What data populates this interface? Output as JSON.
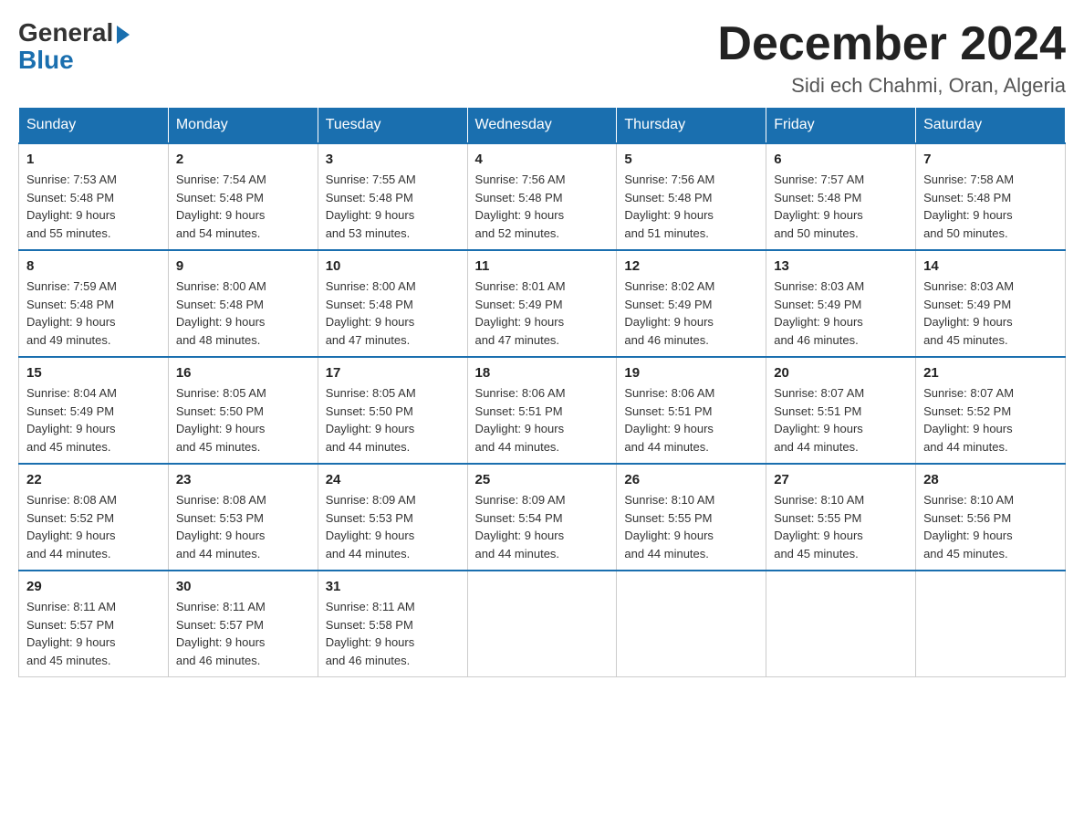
{
  "logo": {
    "general": "General",
    "blue": "Blue"
  },
  "header": {
    "title": "December 2024",
    "subtitle": "Sidi ech Chahmi, Oran, Algeria"
  },
  "days_of_week": [
    "Sunday",
    "Monday",
    "Tuesday",
    "Wednesday",
    "Thursday",
    "Friday",
    "Saturday"
  ],
  "weeks": [
    [
      {
        "day": "1",
        "sunrise": "7:53 AM",
        "sunset": "5:48 PM",
        "daylight": "9 hours and 55 minutes."
      },
      {
        "day": "2",
        "sunrise": "7:54 AM",
        "sunset": "5:48 PM",
        "daylight": "9 hours and 54 minutes."
      },
      {
        "day": "3",
        "sunrise": "7:55 AM",
        "sunset": "5:48 PM",
        "daylight": "9 hours and 53 minutes."
      },
      {
        "day": "4",
        "sunrise": "7:56 AM",
        "sunset": "5:48 PM",
        "daylight": "9 hours and 52 minutes."
      },
      {
        "day": "5",
        "sunrise": "7:56 AM",
        "sunset": "5:48 PM",
        "daylight": "9 hours and 51 minutes."
      },
      {
        "day": "6",
        "sunrise": "7:57 AM",
        "sunset": "5:48 PM",
        "daylight": "9 hours and 50 minutes."
      },
      {
        "day": "7",
        "sunrise": "7:58 AM",
        "sunset": "5:48 PM",
        "daylight": "9 hours and 50 minutes."
      }
    ],
    [
      {
        "day": "8",
        "sunrise": "7:59 AM",
        "sunset": "5:48 PM",
        "daylight": "9 hours and 49 minutes."
      },
      {
        "day": "9",
        "sunrise": "8:00 AM",
        "sunset": "5:48 PM",
        "daylight": "9 hours and 48 minutes."
      },
      {
        "day": "10",
        "sunrise": "8:00 AM",
        "sunset": "5:48 PM",
        "daylight": "9 hours and 47 minutes."
      },
      {
        "day": "11",
        "sunrise": "8:01 AM",
        "sunset": "5:49 PM",
        "daylight": "9 hours and 47 minutes."
      },
      {
        "day": "12",
        "sunrise": "8:02 AM",
        "sunset": "5:49 PM",
        "daylight": "9 hours and 46 minutes."
      },
      {
        "day": "13",
        "sunrise": "8:03 AM",
        "sunset": "5:49 PM",
        "daylight": "9 hours and 46 minutes."
      },
      {
        "day": "14",
        "sunrise": "8:03 AM",
        "sunset": "5:49 PM",
        "daylight": "9 hours and 45 minutes."
      }
    ],
    [
      {
        "day": "15",
        "sunrise": "8:04 AM",
        "sunset": "5:49 PM",
        "daylight": "9 hours and 45 minutes."
      },
      {
        "day": "16",
        "sunrise": "8:05 AM",
        "sunset": "5:50 PM",
        "daylight": "9 hours and 45 minutes."
      },
      {
        "day": "17",
        "sunrise": "8:05 AM",
        "sunset": "5:50 PM",
        "daylight": "9 hours and 44 minutes."
      },
      {
        "day": "18",
        "sunrise": "8:06 AM",
        "sunset": "5:51 PM",
        "daylight": "9 hours and 44 minutes."
      },
      {
        "day": "19",
        "sunrise": "8:06 AM",
        "sunset": "5:51 PM",
        "daylight": "9 hours and 44 minutes."
      },
      {
        "day": "20",
        "sunrise": "8:07 AM",
        "sunset": "5:51 PM",
        "daylight": "9 hours and 44 minutes."
      },
      {
        "day": "21",
        "sunrise": "8:07 AM",
        "sunset": "5:52 PM",
        "daylight": "9 hours and 44 minutes."
      }
    ],
    [
      {
        "day": "22",
        "sunrise": "8:08 AM",
        "sunset": "5:52 PM",
        "daylight": "9 hours and 44 minutes."
      },
      {
        "day": "23",
        "sunrise": "8:08 AM",
        "sunset": "5:53 PM",
        "daylight": "9 hours and 44 minutes."
      },
      {
        "day": "24",
        "sunrise": "8:09 AM",
        "sunset": "5:53 PM",
        "daylight": "9 hours and 44 minutes."
      },
      {
        "day": "25",
        "sunrise": "8:09 AM",
        "sunset": "5:54 PM",
        "daylight": "9 hours and 44 minutes."
      },
      {
        "day": "26",
        "sunrise": "8:10 AM",
        "sunset": "5:55 PM",
        "daylight": "9 hours and 44 minutes."
      },
      {
        "day": "27",
        "sunrise": "8:10 AM",
        "sunset": "5:55 PM",
        "daylight": "9 hours and 45 minutes."
      },
      {
        "day": "28",
        "sunrise": "8:10 AM",
        "sunset": "5:56 PM",
        "daylight": "9 hours and 45 minutes."
      }
    ],
    [
      {
        "day": "29",
        "sunrise": "8:11 AM",
        "sunset": "5:57 PM",
        "daylight": "9 hours and 45 minutes."
      },
      {
        "day": "30",
        "sunrise": "8:11 AM",
        "sunset": "5:57 PM",
        "daylight": "9 hours and 46 minutes."
      },
      {
        "day": "31",
        "sunrise": "8:11 AM",
        "sunset": "5:58 PM",
        "daylight": "9 hours and 46 minutes."
      },
      null,
      null,
      null,
      null
    ]
  ],
  "labels": {
    "sunrise": "Sunrise:",
    "sunset": "Sunset:",
    "daylight": "Daylight:"
  }
}
